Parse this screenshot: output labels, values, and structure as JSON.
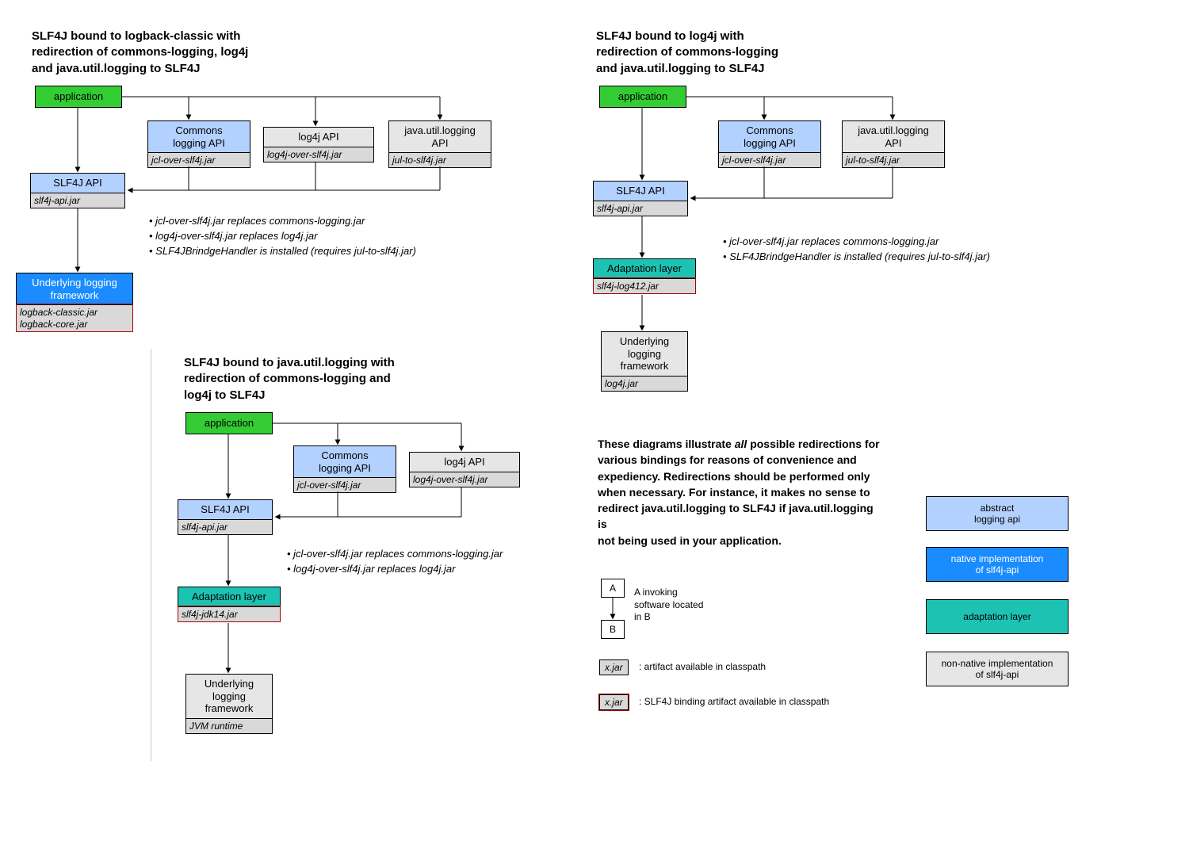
{
  "diagram1": {
    "title": "SLF4J bound to logback-classic with\nredirection of commons-logging, log4j\nand java.util.logging to SLF4J",
    "application": "application",
    "commons": {
      "label": "Commons\nlogging API",
      "jar": "jcl-over-slf4j.jar"
    },
    "log4j": {
      "label": "log4j API",
      "jar": "log4j-over-slf4j.jar"
    },
    "jul": {
      "label": "java.util.logging\nAPI",
      "jar": "jul-to-slf4j.jar"
    },
    "slf4j": {
      "label": "SLF4J API",
      "jar": "slf4j-api.jar"
    },
    "native": {
      "label": "Underlying logging\nframework",
      "jar": "logback-classic.jar\nlogback-core.jar"
    },
    "bullets": [
      "jcl-over-slf4j.jar replaces commons-logging.jar",
      "log4j-over-slf4j.jar replaces log4j.jar",
      "SLF4JBrindgeHandler is installed (requires jul-to-slf4j.jar)"
    ]
  },
  "diagram2": {
    "title": "SLF4J bound to java.util.logging with\nredirection of commons-logging and\nlog4j to SLF4J",
    "application": "application",
    "commons": {
      "label": "Commons\nlogging API",
      "jar": "jcl-over-slf4j.jar"
    },
    "log4j": {
      "label": "log4j API",
      "jar": "log4j-over-slf4j.jar"
    },
    "slf4j": {
      "label": "SLF4J API",
      "jar": "slf4j-api.jar"
    },
    "adapt": {
      "label": "Adaptation layer",
      "jar": "slf4j-jdk14.jar"
    },
    "native": {
      "label": "Underlying\nlogging\nframework",
      "jar": "JVM runtime"
    },
    "bullets": [
      "jcl-over-slf4j.jar replaces commons-logging.jar",
      "log4j-over-slf4j.jar replaces log4j.jar"
    ]
  },
  "diagram3": {
    "title": "SLF4J bound to log4j with\nredirection of commons-logging\nand java.util.logging to SLF4J",
    "application": "application",
    "commons": {
      "label": "Commons\nlogging API",
      "jar": "jcl-over-slf4j.jar"
    },
    "jul": {
      "label": "java.util.logging\nAPI",
      "jar": "jul-to-slf4j.jar"
    },
    "slf4j": {
      "label": "SLF4J API",
      "jar": "slf4j-api.jar"
    },
    "adapt": {
      "label": "Adaptation layer",
      "jar": "slf4j-log412.jar"
    },
    "native": {
      "label": "Underlying\nlogging\nframework",
      "jar": "log4j.jar"
    },
    "bullets": [
      "jcl-over-slf4j.jar replaces commons-logging.jar",
      "SLF4JBrindgeHandler is installed (requires jul-to-slf4j.jar)"
    ]
  },
  "disclaimer": "These diagrams illustrate all possible redirections for various bindings for reasons of convenience and expediency. Redirections should be performed only when necessary. For instance, it makes no sense to redirect java.util.logging to SLF4J if java.util.logging is not being used in your application.",
  "legend": {
    "ab_a": "A",
    "ab_b": "B",
    "ab_text": "A invoking\nsoftware located\nin B",
    "jar_label": "x.jar",
    "jar_text": ": artifact available in classpath",
    "jar_red_label": "x.jar",
    "jar_red_text": ": SLF4J binding artifact available in classpath",
    "abstract": "abstract\nlogging api",
    "native": "native implementation\nof slf4j-api",
    "adapt": "adaptation layer",
    "nonnative": "non-native implementation\nof slf4j-api"
  }
}
